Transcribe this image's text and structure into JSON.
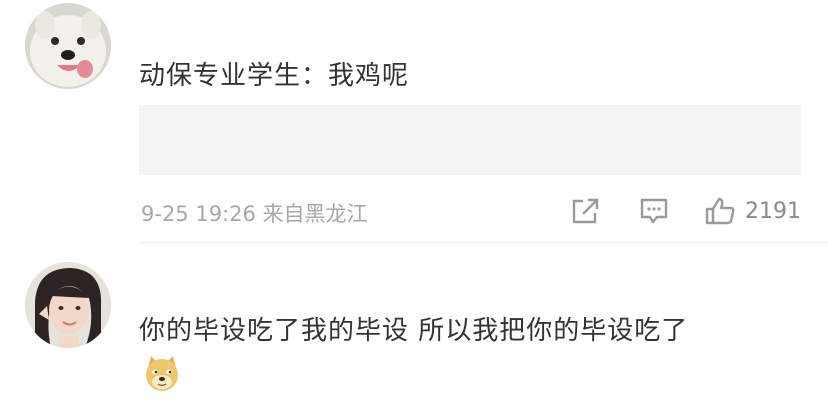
{
  "comments": [
    {
      "avatar": "samoyed-dog-avatar",
      "user_line": "动保专业学生：我鸡呢",
      "time": "9-25 19:26 来自黑龙江",
      "likes": "2191"
    },
    {
      "avatar": "user-girl-avatar",
      "text": "你的毕设吃了我的毕设 所以我把你的毕设吃了",
      "emoji": "doge-emoji"
    }
  ],
  "icons": {
    "share": "share-icon",
    "comment": "comment-icon",
    "like": "thumbs-up-icon"
  },
  "colors": {
    "meta_text": "#a7a7a7",
    "icon": "#9a9a9a",
    "quote_bg": "#f4f4f4"
  }
}
